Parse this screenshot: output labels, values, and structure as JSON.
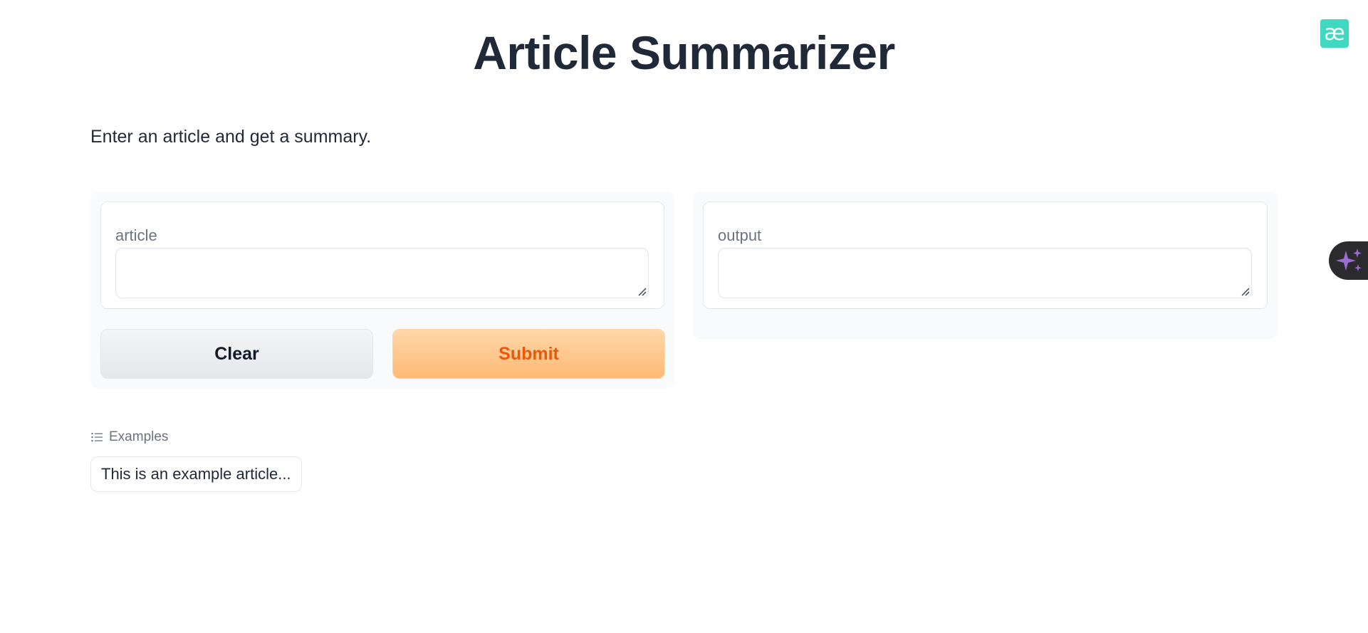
{
  "header": {
    "title": "Article Summarizer",
    "logo_text": "æ",
    "logo_color": "#3fd9c2"
  },
  "description": "Enter an article and get a summary.",
  "input_panel": {
    "label": "article",
    "value": "",
    "clear_label": "Clear",
    "submit_label": "Submit"
  },
  "output_panel": {
    "label": "output",
    "value": ""
  },
  "examples": {
    "header": "Examples",
    "items": [
      "This is an example article..."
    ]
  },
  "floating_tab": {
    "icon": "sparkle-icon",
    "icon_color": "#9b6bd6"
  },
  "colors": {
    "accent": "#ea580c",
    "submit_bg": "#fdba74",
    "panel_bg": "#f9fafb"
  }
}
